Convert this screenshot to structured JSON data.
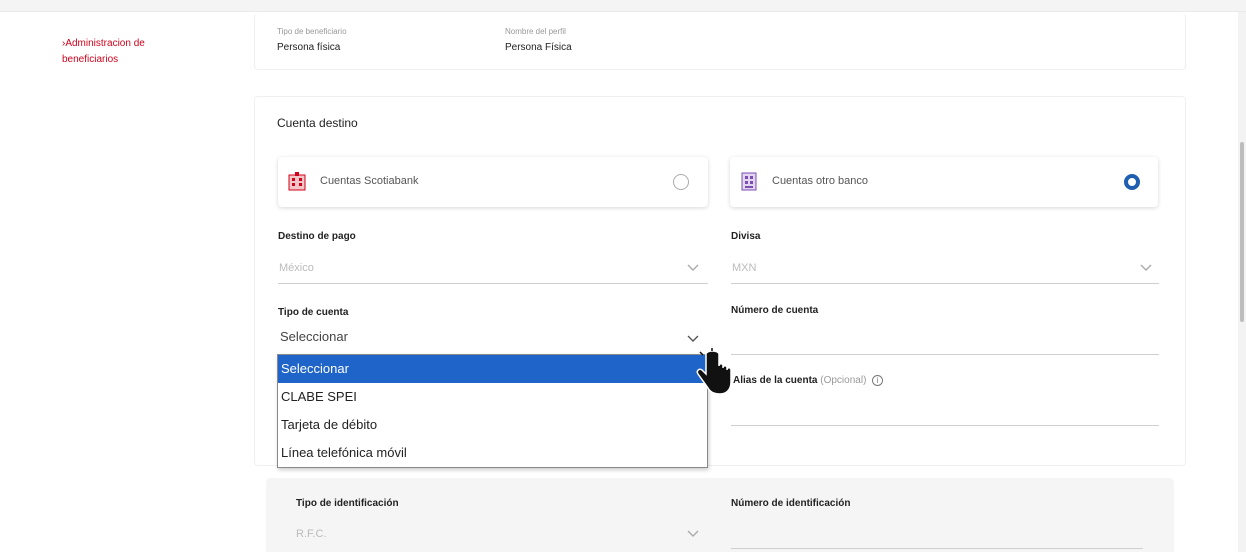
{
  "sidebar": {
    "link_label": "›Administracion de beneficiarios"
  },
  "profile": {
    "beneficiary_type_label": "Tipo de beneficiario",
    "beneficiary_type_value": "Persona física",
    "profile_name_label": "Nombre del perfil",
    "profile_name_value": "Persona Física"
  },
  "account": {
    "title": "Cuenta destino",
    "option_scotiabank": "Cuentas Scotiabank",
    "option_other_bank": "Cuentas otro banco",
    "selected_option": "Cuentas otro banco"
  },
  "fields": {
    "destination_label": "Destino de pago",
    "destination_value": "México",
    "currency_label": "Divisa",
    "currency_value": "MXN",
    "account_type_label": "Tipo de cuenta",
    "account_type_value": "Seleccionar",
    "account_number_label": "Número de cuenta",
    "alias_label": "Alias de la cuenta",
    "alias_optional": "(Opcional)",
    "id_type_label": "Tipo de identificación",
    "id_type_value": "R.F.C.",
    "id_number_label": "Número de identificación"
  },
  "dropdown": {
    "options": [
      "Seleccionar",
      "CLABE SPEI",
      "Tarjeta de débito",
      "Línea telefónica móvil"
    ],
    "highlighted": "Seleccionar"
  },
  "colors": {
    "accent_red": "#d0021b",
    "accent_blue": "#1f5fb0",
    "highlight_blue": "#1f64c8"
  }
}
